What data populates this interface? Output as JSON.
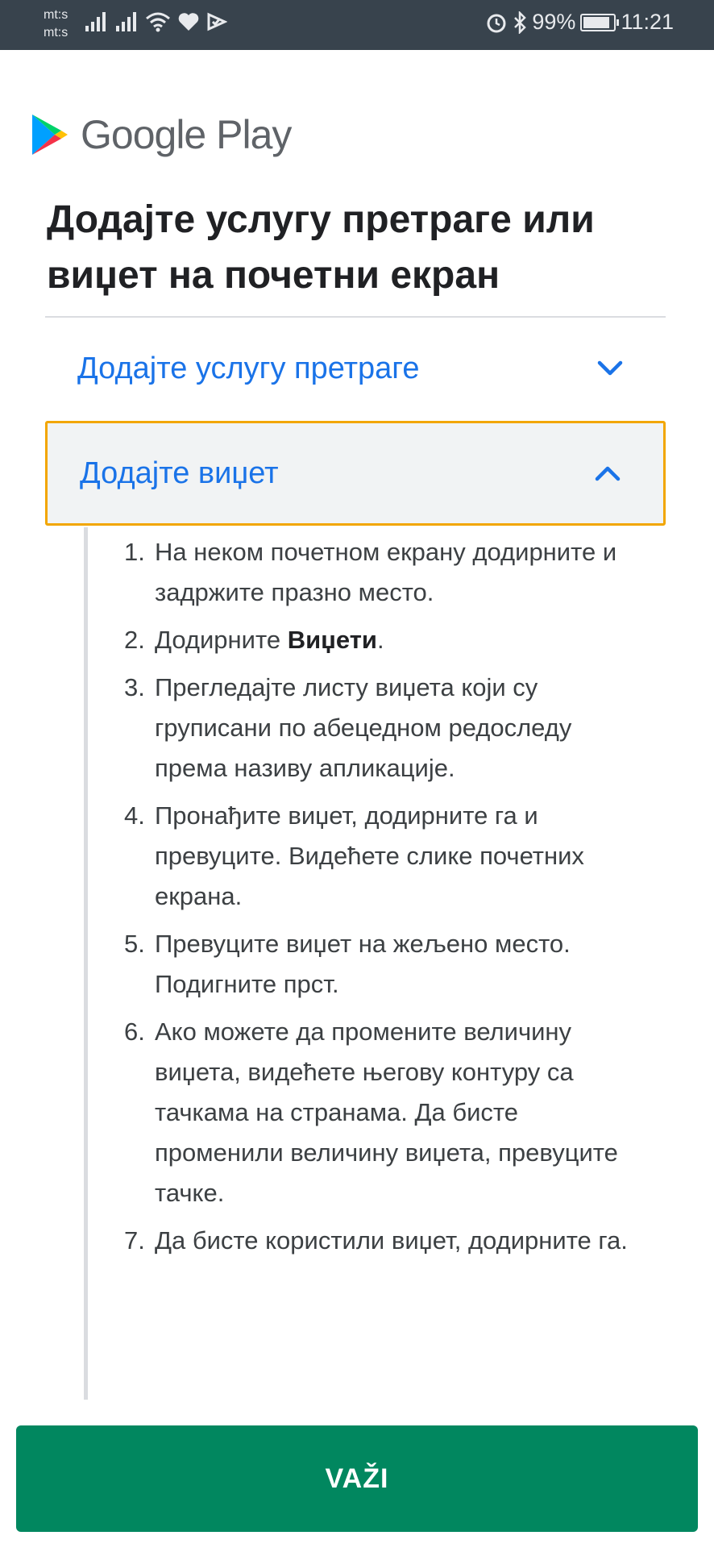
{
  "status_bar": {
    "carrier_1": "mt:s",
    "carrier_2": "mt:s",
    "battery_percent": "99%",
    "battery_level": 0.99,
    "time": "11:21",
    "icons": [
      "signal-icon",
      "signal-icon",
      "wifi-icon",
      "heart-icon",
      "check-icon",
      "alarm-icon",
      "bluetooth-icon",
      "battery-icon"
    ]
  },
  "brand": {
    "name": "Google Play",
    "colors": {
      "green": "#01875f",
      "blue": "#1a73e8",
      "focus": "#f2a600"
    }
  },
  "title": "Додајте услугу претраге или виџет на почетни екран",
  "accordion": [
    {
      "label": "Додајте услугу претраге",
      "expanded": false,
      "icon": "chevron-down-icon"
    },
    {
      "label": "Додајте виџет",
      "expanded": true,
      "icon": "chevron-up-icon"
    }
  ],
  "steps": [
    {
      "num": "1.",
      "text": "На неком почетном екрану додирните и задржите празно место."
    },
    {
      "num": "2.",
      "before": "Додирните ",
      "bold": "Виџети",
      "after": "."
    },
    {
      "num": "3.",
      "text": "Прегледајте листу виџета који су груписани по абецедном редоследу према називу апликације."
    },
    {
      "num": "4.",
      "text": "Пронађите виџет, додирните га и превуците. Видећете слике почетних екрана."
    },
    {
      "num": "5.",
      "text": "Превуците виџет на жељено место. Подигните прст."
    },
    {
      "num": "6.",
      "text": "Ако можете да промените величину виџета, видећете његову контуру са тачкама на странама. Да бисте променили величину виџета, превуците тачке."
    },
    {
      "num": "7.",
      "text": "Да бисте користили виџет, додирните га."
    }
  ],
  "button": {
    "label": "VAŽI"
  }
}
